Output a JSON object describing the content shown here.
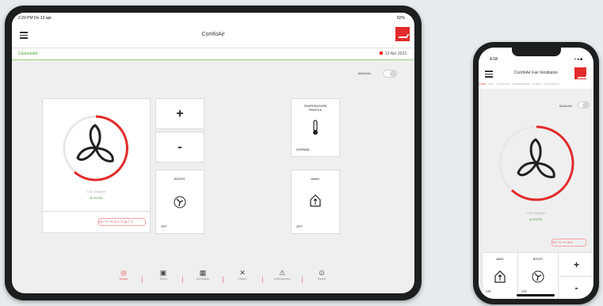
{
  "tablet": {
    "status": {
      "time": "2:29 PM  Do 13 apr.",
      "system": "82%"
    },
    "title": "ComfoAir",
    "connection": "Connected",
    "date": "13 Apr 2023",
    "manual_label": "MANUAL",
    "fan": {
      "label": "CO₂ 541ppm",
      "status": "GOOD",
      "temp_in": "16.7 °C",
      "temp_out": "21.0 °C",
      "temp_out2": "16.7 °C"
    },
    "plus": "+",
    "minus": "-",
    "boost": {
      "label": "BOOST",
      "state": "OFF"
    },
    "temperature": {
      "label": "TEMPERATURE PROFILE",
      "state": "NORMAL"
    },
    "away": {
      "label": "AWAY",
      "state": "OFF"
    },
    "nav": [
      {
        "label": "Home",
        "icon": "home-icon"
      },
      {
        "label": "Timer",
        "icon": "clipboard-icon"
      },
      {
        "label": "Schedule",
        "icon": "calendar-icon"
      },
      {
        "label": "Filters",
        "icon": "tools-icon"
      },
      {
        "label": "Unit alarms",
        "icon": "warning-icon"
      },
      {
        "label": "Reset",
        "icon": "reset-icon"
      }
    ]
  },
  "phone": {
    "status": {
      "time": "4:18",
      "system": "▪ ◂ ■"
    },
    "title": "ComfoAir Fan Ventilation",
    "tabs": [
      "HOME",
      "AWAY",
      "SCHEDULE",
      "TEMPERATURE",
      "FILTERS",
      "UNIT STATUS"
    ],
    "manual_label": "MANUAL",
    "fan": {
      "label": "CO₂ 541ppm",
      "status": "GOOD",
      "temp": "16.7 °C",
      "temp2": "21.0"
    },
    "away": {
      "label": "AWAY",
      "state": "OFF"
    },
    "boost": {
      "label": "BOOST",
      "state": "OFF"
    },
    "plus": "+",
    "minus": "-"
  },
  "colors": {
    "accent": "#e32b2b",
    "connected": "#3f9d2c"
  }
}
